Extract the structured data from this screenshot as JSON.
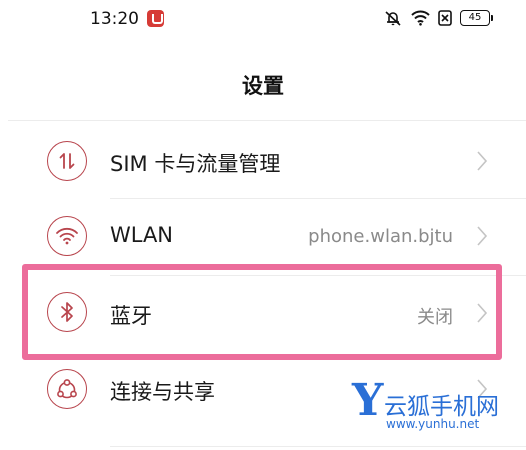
{
  "status_bar": {
    "time": "13:20",
    "battery_level": "45",
    "icons": [
      "app-notification-icon",
      "mute-icon",
      "wifi-icon",
      "no-sim-icon",
      "battery-icon"
    ]
  },
  "header": {
    "title": "设置"
  },
  "settings": [
    {
      "id": "sim",
      "icon": "sim-data-icon",
      "label": "SIM 卡与流量管理",
      "value": ""
    },
    {
      "id": "wlan",
      "icon": "wifi-icon",
      "label": "WLAN",
      "value": "phone.wlan.bjtu"
    },
    {
      "id": "bluetooth",
      "icon": "bluetooth-icon",
      "label": "蓝牙",
      "value": "关闭",
      "highlighted": true
    },
    {
      "id": "connection",
      "icon": "connection-sharing-icon",
      "label": "连接与共享",
      "value": ""
    }
  ],
  "watermark": {
    "name": "云狐手机网",
    "url": "www.yunhu.net"
  },
  "colors": {
    "icon_accent": "#b8454d",
    "highlight_border": "#ec6d9b",
    "watermark": "#2a6fd6",
    "secondary_text": "#8a8a8a"
  }
}
